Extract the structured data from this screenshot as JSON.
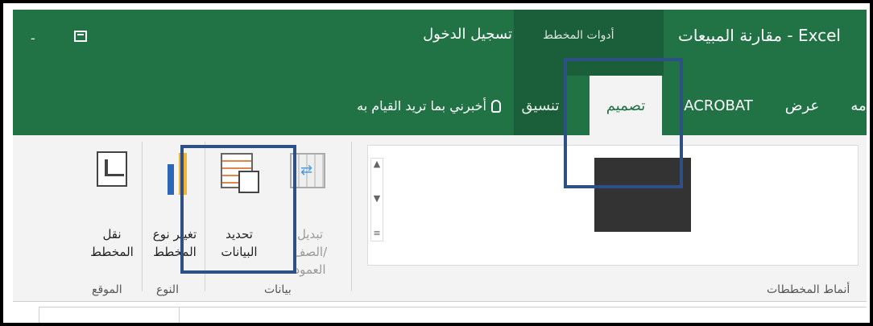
{
  "title_bar": {
    "login": "تسجيل الدخول",
    "document_title": "مقارنة المبيعات - Excel",
    "context_tab_label": "أدوات المخطط",
    "dash": "-"
  },
  "tabs": {
    "format": "تنسيق",
    "design": "تصميم",
    "acrobat": "ACROBAT",
    "view": "عرض",
    "partial": "مه",
    "tell_me": "أخبرني بما تريد القيام به"
  },
  "ribbon": {
    "groups": {
      "location": "الموقع",
      "type": "النوع",
      "data": "بيانات",
      "styles": "أنماط المخططات"
    },
    "buttons": {
      "move_chart": [
        "نقل",
        "المخطط"
      ],
      "change_type": [
        "تغيير نوع",
        "المخطط"
      ],
      "select_data": [
        "تحديد",
        "البيانات"
      ],
      "switch_row_col": [
        "تبديل الصف/",
        "العمود"
      ]
    }
  },
  "colors": {
    "excel_green": "#217346",
    "highlight": "#2f4f87"
  },
  "icons": [
    "quick-access-icon",
    "bulb-icon",
    "move-chart-icon",
    "change-chart-type-icon",
    "select-data-icon",
    "switch-row-column-icon",
    "gallery-scroll-up-icon",
    "gallery-scroll-down-icon",
    "gallery-more-icon"
  ]
}
